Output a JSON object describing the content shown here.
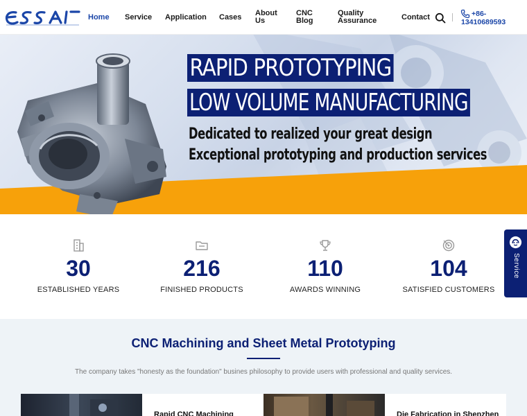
{
  "header": {
    "logo_text": "ESSAI",
    "nav": [
      {
        "label": "Home",
        "active": true
      },
      {
        "label": "Service"
      },
      {
        "label": "Application"
      },
      {
        "label": "Cases"
      },
      {
        "label": "About Us"
      },
      {
        "label": "CNC Blog"
      },
      {
        "label": "Quality Assurance"
      },
      {
        "label": "Contact"
      }
    ],
    "phone_line1": "+86-",
    "phone_line2": "13410689593"
  },
  "hero": {
    "headline_1": "RAPID PROTOTYPING",
    "headline_2": "LOW VOLUME MANUFACTURING",
    "subheadline_1": "Dedicated to realized your great design",
    "subheadline_2": "Exceptional prototyping and production services",
    "accent_color": "#f7a10a"
  },
  "stats": [
    {
      "value": "30",
      "label": "ESTABLISHED YEARS",
      "icon": "building-icon"
    },
    {
      "value": "216",
      "label": "FINISHED PRODUCTS",
      "icon": "folder-icon"
    },
    {
      "value": "110",
      "label": "AWARDS WINNING",
      "icon": "trophy-icon"
    },
    {
      "value": "104",
      "label": "SATISFIED CUSTOMERS",
      "icon": "target-icon"
    }
  ],
  "service_tab": {
    "label": "Service"
  },
  "section": {
    "title": "CNC Machining and Sheet Metal Prototyping",
    "description": "The company takes \"honesty as the foundation\" busines philosophy to provide users with professional and quality services.",
    "cards": [
      {
        "title": "Rapid CNC Machining"
      },
      {
        "title": "Die Fabrication in Shenzhen"
      }
    ]
  },
  "colors": {
    "brand": "#0c2074",
    "link": "#1b46a8",
    "accent": "#f7a10a",
    "section_bg": "#eef3f7"
  }
}
